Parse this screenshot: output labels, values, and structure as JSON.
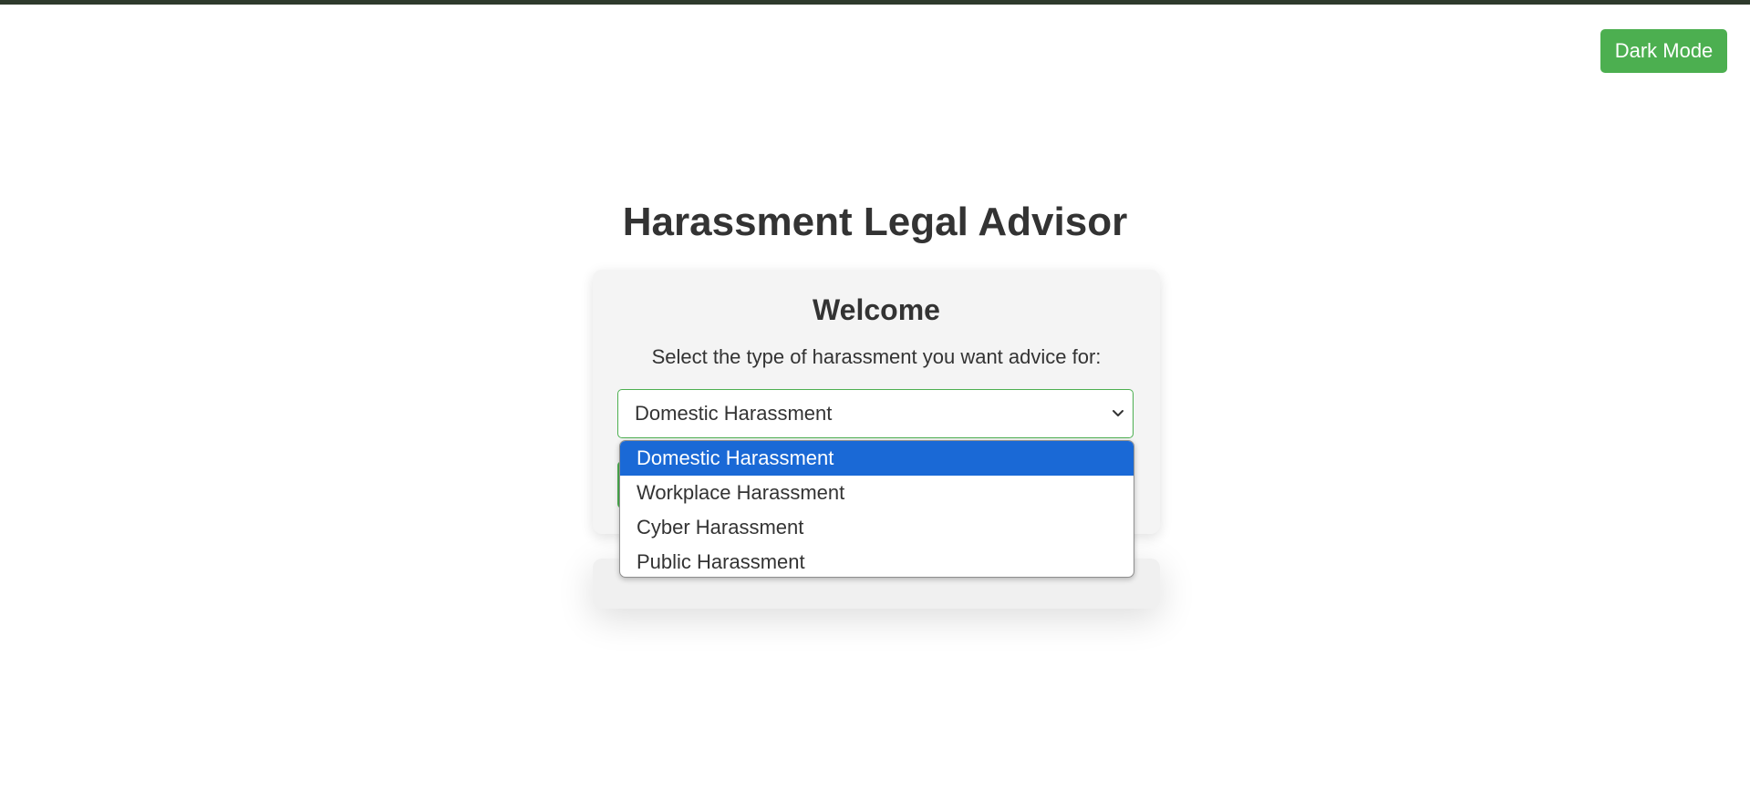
{
  "theme_button": {
    "label": "Dark Mode"
  },
  "header": {
    "title": "Harassment Legal Advisor"
  },
  "card": {
    "heading": "Welcome",
    "prompt": "Select the type of harassment you want advice for:",
    "select": {
      "selected_value": "Domestic Harassment",
      "icon": "chevron-down-icon",
      "options": [
        {
          "label": "Domestic Harassment",
          "selected": true
        },
        {
          "label": "Workplace Harassment",
          "selected": false
        },
        {
          "label": "Cyber Harassment",
          "selected": false
        },
        {
          "label": "Public Harassment",
          "selected": false
        }
      ]
    }
  },
  "colors": {
    "accent": "#4caf50",
    "top_bar": "#2e3a2c",
    "option_highlight": "#1a69d6",
    "card_background": "#f4f4f4",
    "text": "#333333"
  }
}
